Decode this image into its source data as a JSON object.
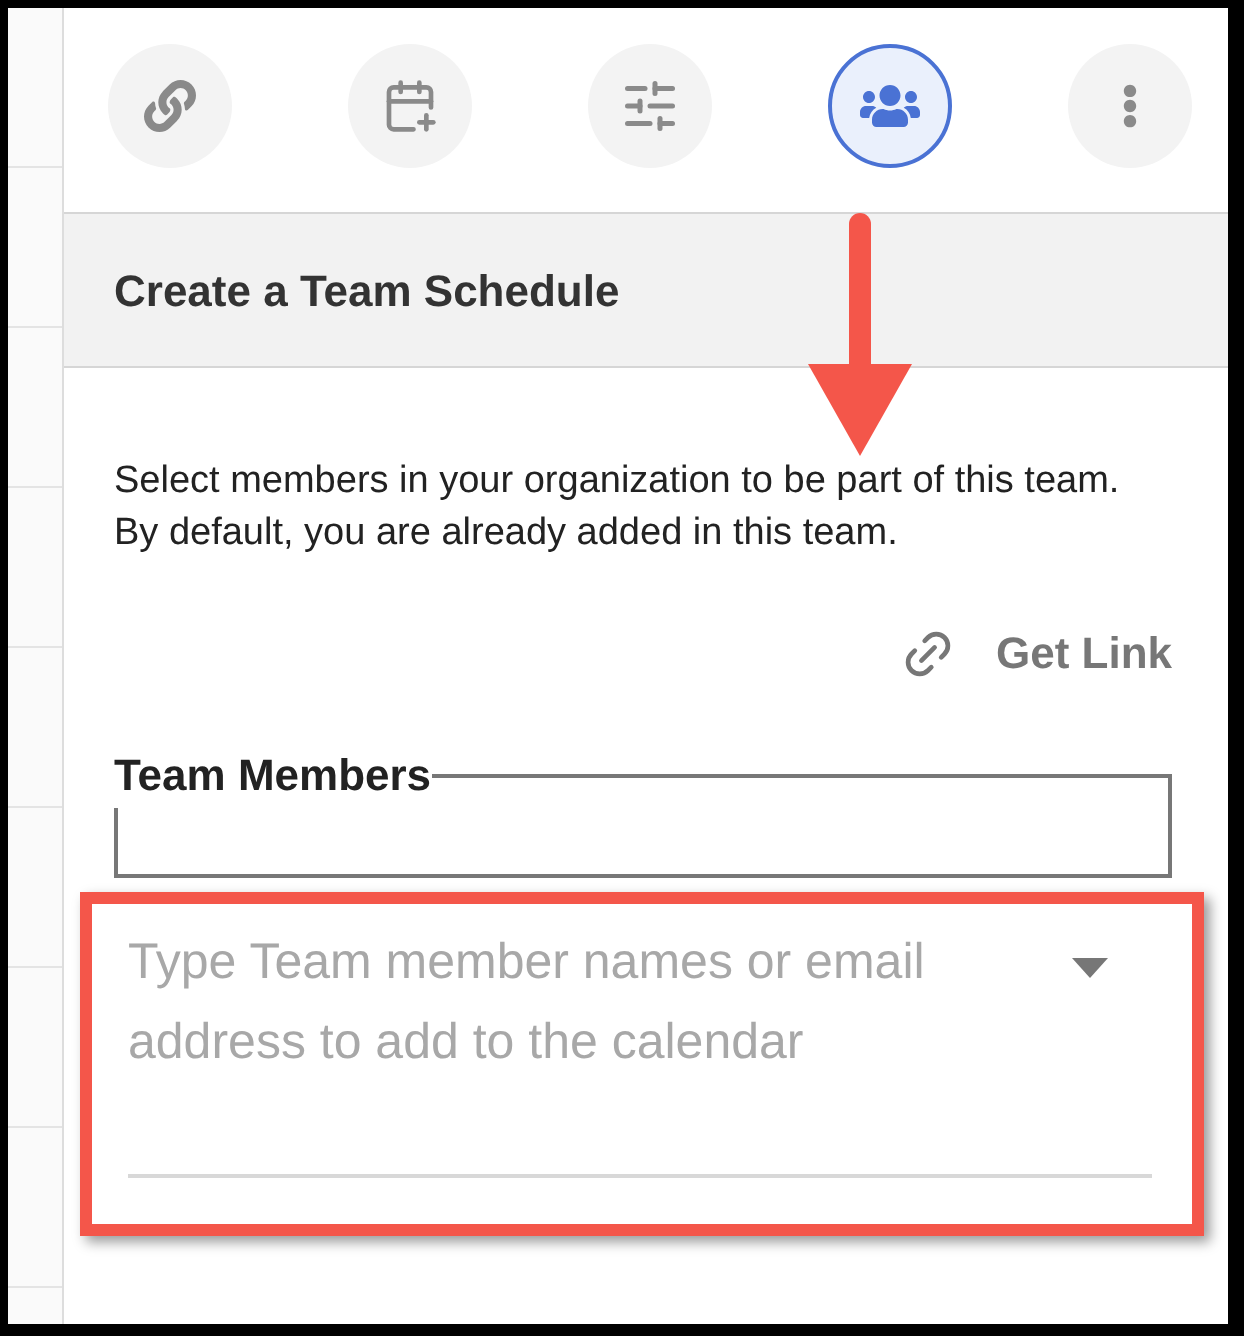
{
  "toolbar": [
    {
      "kind": "link",
      "selected": false
    },
    {
      "kind": "calendar",
      "selected": false
    },
    {
      "kind": "filters",
      "selected": false
    },
    {
      "kind": "team",
      "selected": true
    },
    {
      "kind": "more",
      "selected": false
    }
  ],
  "header": {
    "title": "Create a Team Schedule"
  },
  "description": "Select members in your organization to be part of this team. By default, you are already added in this team.",
  "get_link": "Get Link",
  "team_members": {
    "legend": "Team Members"
  },
  "member_search": {
    "placeholder": "Type Team member names or email address to add to the calendar"
  }
}
